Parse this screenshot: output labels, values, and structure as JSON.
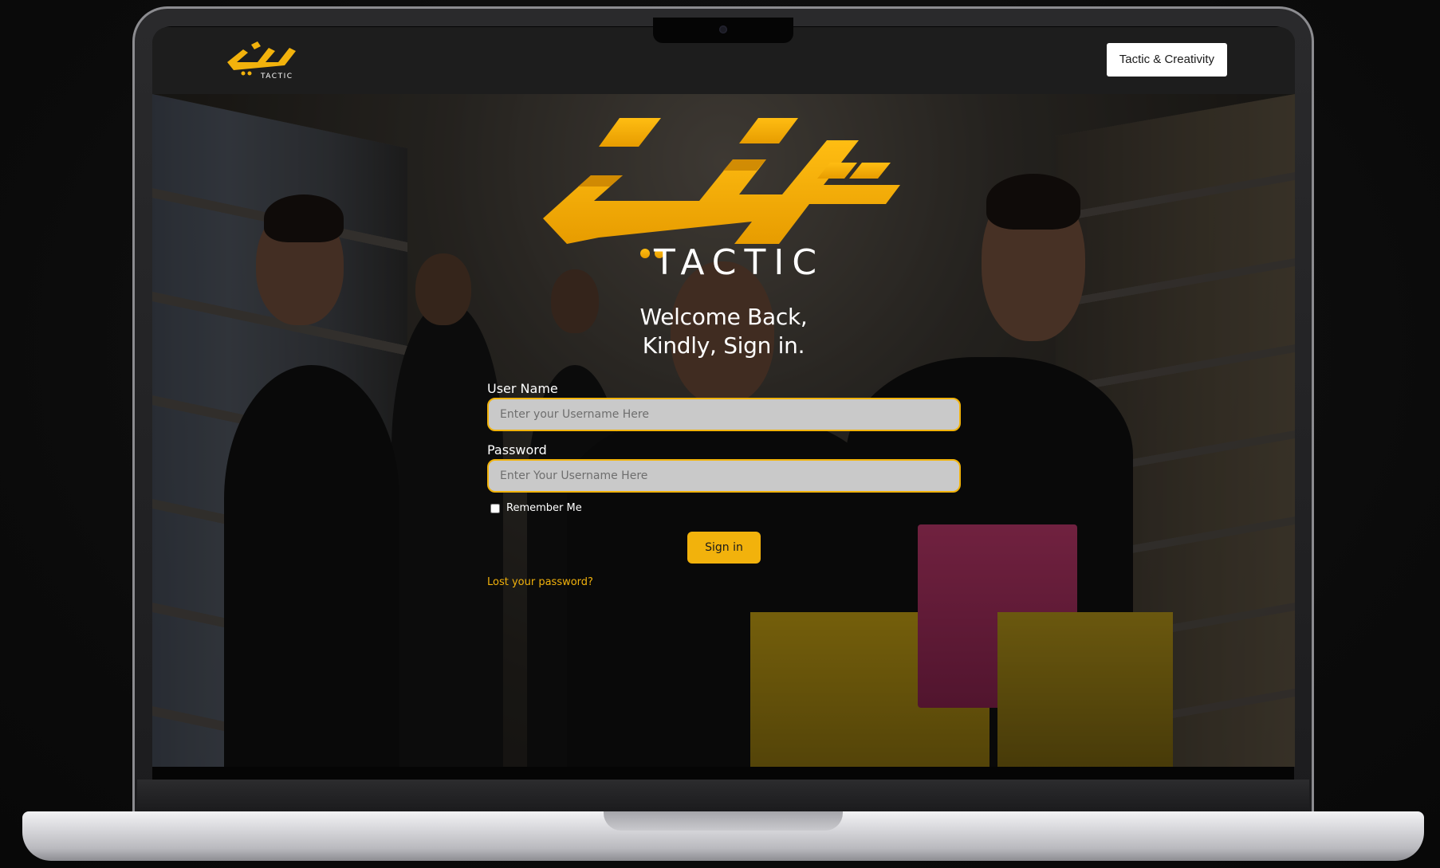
{
  "header": {
    "logo_arabic": "تكتيك",
    "logo_latin": "TACTIC",
    "button_label": "Tactic & Creativity"
  },
  "hero": {
    "brand_arabic": "تكتيك",
    "brand_latin": "TACTIC"
  },
  "login": {
    "welcome_line1": "Welcome Back,",
    "welcome_line2": "Kindly, Sign in.",
    "username_label": "User Name",
    "username_placeholder": "Enter your Username Here",
    "password_label": "Password",
    "password_placeholder": "Enter Your Username Here",
    "remember_label": "Remember Me",
    "signin_label": "Sign in",
    "lost_password": "Lost your password?"
  },
  "colors": {
    "accent": "#f2b20c",
    "header_bg": "#1d1d1d",
    "input_bg": "#c9c9c9"
  }
}
